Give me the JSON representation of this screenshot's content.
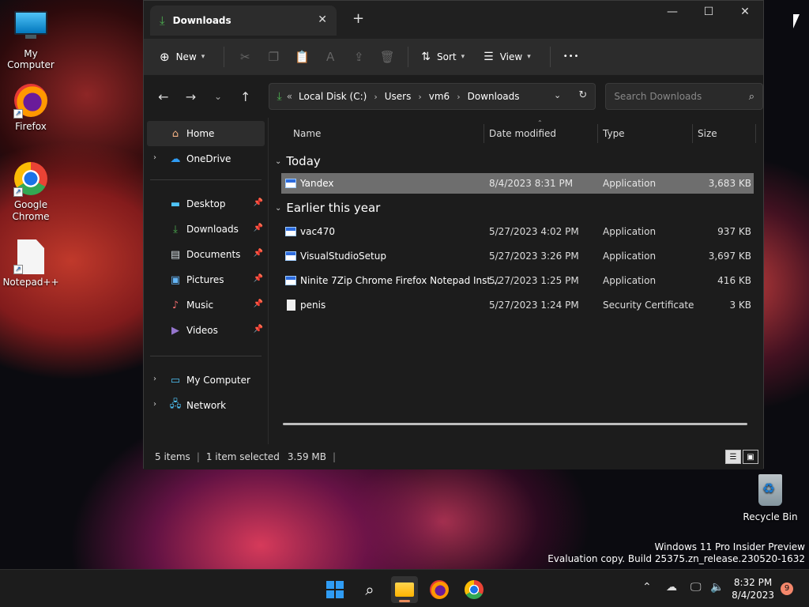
{
  "desktop": {
    "icons": [
      {
        "label": "My Computer"
      },
      {
        "label": "Firefox"
      },
      {
        "label": "Google Chrome"
      },
      {
        "label": "Notepad++"
      },
      {
        "label": "Recycle Bin"
      }
    ],
    "watermark_line1": "Windows 11 Pro Insider Preview",
    "watermark_line2": "Evaluation copy. Build 25375.zn_release.230520-1632"
  },
  "window": {
    "tab_title": "Downloads",
    "toolbar": {
      "new_label": "New",
      "sort_label": "Sort",
      "view_label": "View",
      "more_label": "•••"
    },
    "address": {
      "overflow": "«",
      "crumbs": [
        "Local Disk (C:)",
        "Users",
        "vm6",
        "Downloads"
      ]
    },
    "search_placeholder": "Search Downloads",
    "sidebar": {
      "home": "Home",
      "onedrive": "OneDrive",
      "quick": [
        "Desktop",
        "Downloads",
        "Documents",
        "Pictures",
        "Music",
        "Videos"
      ],
      "my_computer": "My Computer",
      "network": "Network"
    },
    "columns": {
      "name": "Name",
      "date": "Date modified",
      "type": "Type",
      "size": "Size"
    },
    "groups": {
      "today": "Today",
      "earlier": "Earlier this year"
    },
    "files_today": [
      {
        "name": "Yandex",
        "date": "8/4/2023 8:31 PM",
        "type": "Application",
        "size": "3,683 KB"
      }
    ],
    "files_earlier": [
      {
        "name": "vac470",
        "date": "5/27/2023 4:02 PM",
        "type": "Application",
        "size": "937 KB"
      },
      {
        "name": "VisualStudioSetup",
        "date": "5/27/2023 3:26 PM",
        "type": "Application",
        "size": "3,697 KB"
      },
      {
        "name": "Ninite 7Zip Chrome Firefox Notepad Inst...",
        "date": "5/27/2023 1:25 PM",
        "type": "Application",
        "size": "416 KB"
      },
      {
        "name": "penis",
        "date": "5/27/2023 1:24 PM",
        "type": "Security Certificate",
        "size": "3 KB"
      }
    ],
    "status": {
      "items": "5 items",
      "selected": "1 item selected",
      "selected_size": "3.59 MB"
    }
  },
  "taskbar": {
    "time": "8:32 PM",
    "date": "8/4/2023",
    "notification_count": "9"
  }
}
